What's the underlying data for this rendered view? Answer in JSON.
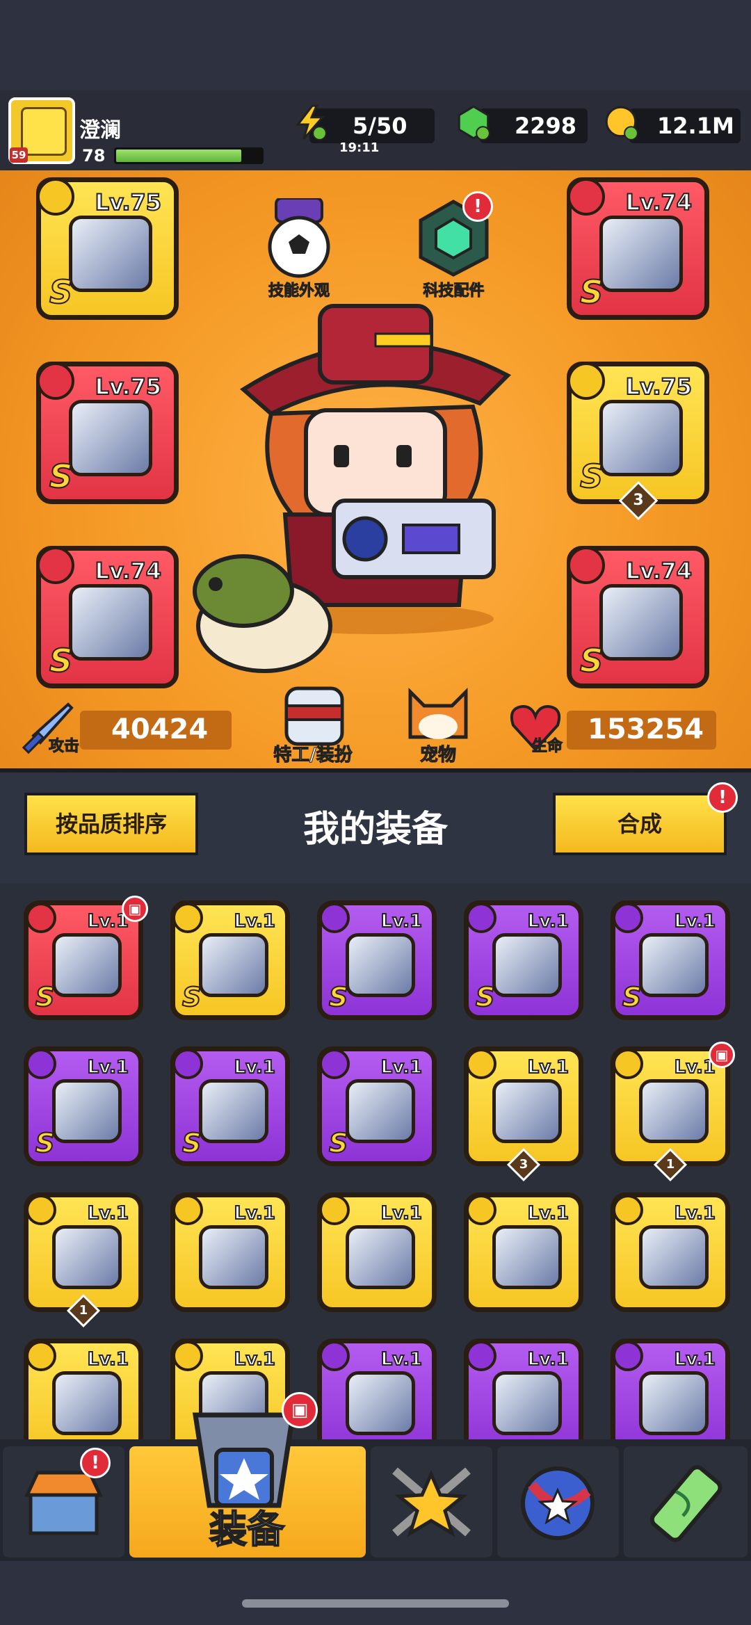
{
  "player": {
    "name": "澄澜",
    "level": "78",
    "avatar_level": "59",
    "xp_fraction": 0.86
  },
  "resources": {
    "energy": {
      "value": "5/50",
      "timer": "19:11",
      "icon": "lightning-icon"
    },
    "gems": {
      "value": "2298",
      "icon": "green-gem-icon"
    },
    "coins": {
      "value": "12.1M",
      "icon": "gold-coin-icon"
    }
  },
  "hero": {
    "left_slots": [
      {
        "level": "Lv.75",
        "rank": "S",
        "type_icon": "weapon-icon",
        "color": "yellow"
      },
      {
        "level": "Lv.75",
        "rank": "S",
        "type_icon": "necklace-icon",
        "color": "red"
      },
      {
        "level": "Lv.74",
        "rank": "S",
        "type_icon": "glove-icon",
        "color": "red"
      }
    ],
    "right_slots": [
      {
        "level": "Lv.74",
        "rank": "S",
        "type_icon": "armor-icon",
        "color": "red"
      },
      {
        "level": "Lv.75",
        "rank": "S",
        "type_icon": "belt-icon",
        "color": "yellow",
        "count": "3"
      },
      {
        "level": "Lv.74",
        "rank": "S",
        "type_icon": "boots-icon",
        "color": "red"
      }
    ],
    "skill_skin_label": "技能外观",
    "tech_parts_label": "科技配件",
    "agent_label": "特工/装扮",
    "pet_label": "宠物",
    "attack": {
      "label": "攻击",
      "value": "40424"
    },
    "hp": {
      "label": "生命",
      "value": "153254"
    }
  },
  "mid": {
    "sort_label": "按品质排序",
    "title": "我的装备",
    "synth_label": "合成",
    "synth_badge": "!"
  },
  "inventory": [
    {
      "level": "Lv.1",
      "rank": "S",
      "color": "red",
      "type_icon": "weapon-icon",
      "badge": true
    },
    {
      "level": "Lv.1",
      "rank": "S",
      "color": "yellow",
      "type_icon": "boots-icon"
    },
    {
      "level": "Lv.1",
      "rank": "S",
      "color": "purple",
      "type_icon": "weapon-icon"
    },
    {
      "level": "Lv.1",
      "rank": "S",
      "color": "purple",
      "type_icon": "weapon-icon"
    },
    {
      "level": "Lv.1",
      "rank": "S",
      "color": "purple",
      "type_icon": "weapon-icon"
    },
    {
      "level": "Lv.1",
      "rank": "S",
      "color": "purple",
      "type_icon": "armor-icon"
    },
    {
      "level": "Lv.1",
      "rank": "S",
      "color": "purple",
      "type_icon": "armor-icon"
    },
    {
      "level": "Lv.1",
      "rank": "S",
      "color": "purple",
      "type_icon": "belt-icon"
    },
    {
      "level": "Lv.1",
      "rank": "",
      "color": "yellow",
      "type_icon": "necklace-icon",
      "count": "3"
    },
    {
      "level": "Lv.1",
      "rank": "",
      "color": "yellow",
      "type_icon": "weapon-icon",
      "count": "1",
      "badge": true
    },
    {
      "level": "Lv.1",
      "rank": "",
      "color": "yellow",
      "type_icon": "armor-icon",
      "count": "1"
    },
    {
      "level": "Lv.1",
      "rank": "",
      "color": "yellow",
      "type_icon": "weapon-icon"
    },
    {
      "level": "Lv.1",
      "rank": "",
      "color": "yellow",
      "type_icon": "weapon-icon"
    },
    {
      "level": "Lv.1",
      "rank": "",
      "color": "yellow",
      "type_icon": "armor-icon"
    },
    {
      "level": "Lv.1",
      "rank": "",
      "color": "yellow",
      "type_icon": "armor-icon"
    },
    {
      "level": "Lv.1",
      "rank": "",
      "color": "yellow",
      "type_icon": "necklace-icon"
    },
    {
      "level": "Lv.1",
      "rank": "",
      "color": "yellow",
      "type_icon": "glove-icon"
    },
    {
      "level": "Lv.1",
      "rank": "",
      "color": "purple",
      "type_icon": "weapon-icon"
    },
    {
      "level": "Lv.1",
      "rank": "",
      "color": "purple",
      "type_icon": "weapon-icon"
    },
    {
      "level": "Lv.1",
      "rank": "",
      "color": "purple",
      "type_icon": "armor-icon"
    }
  ],
  "nav": {
    "tabs": [
      {
        "name": "shop",
        "icon": "shop-icon",
        "badge": "!"
      },
      {
        "name": "equipment",
        "label": "装备",
        "icon": "equipment-icon",
        "active": true
      },
      {
        "name": "talent",
        "icon": "star-swords-icon"
      },
      {
        "name": "pets",
        "icon": "stars-orb-icon"
      },
      {
        "name": "dna",
        "icon": "dna-capsule-icon"
      }
    ]
  },
  "colors": {
    "red": "#e23445",
    "yellow": "#f6c624",
    "purple": "#8e33d6",
    "orange_bg": "#f59a26",
    "accent_green": "#5db53a"
  }
}
